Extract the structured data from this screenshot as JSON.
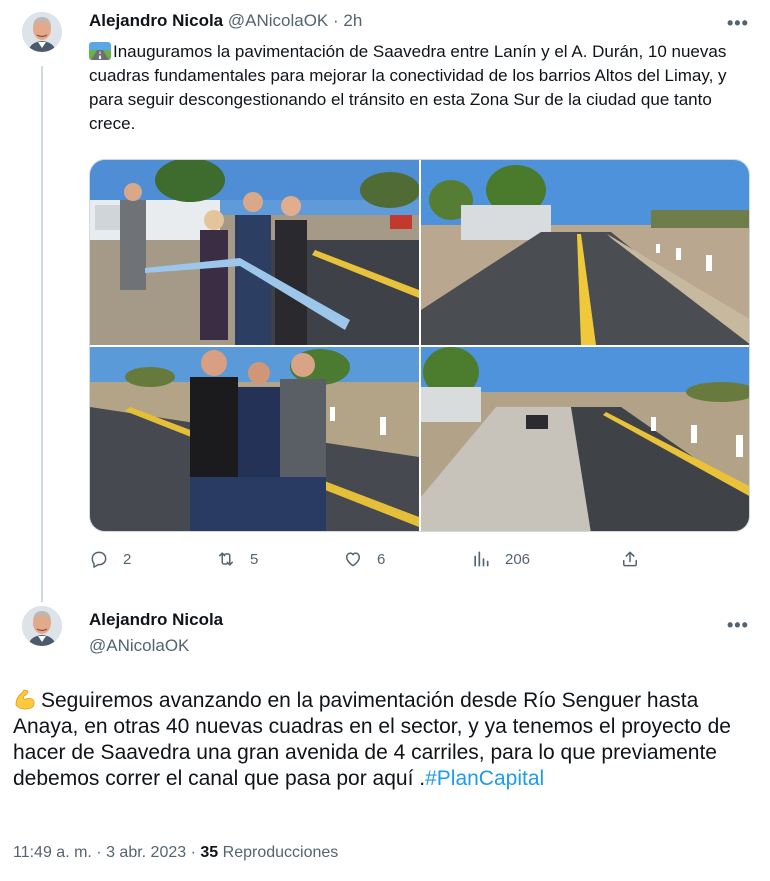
{
  "first_tweet": {
    "author_name": "Alejandro Nicola",
    "author_handle": "@ANicolaOK",
    "separator": "·",
    "time": "2h",
    "more_label": "•••",
    "text": "Inauguramos la pavimentación de Saavedra entre Lanín y el A. Durán, 10 nuevas cuadras fundamentales para mejorar la conectividad de los barrios Altos del Limay, y para seguir descongestionando el tránsito en esta Zona Sur de la ciudad que tanto crece.",
    "emoji": "road-icon",
    "actions": {
      "replies": "2",
      "retweets": "5",
      "likes": "6",
      "views": "206"
    }
  },
  "second_tweet": {
    "author_name": "Alejandro Nicola",
    "author_handle": "@ANicolaOK",
    "more_label": "•••",
    "emoji": "flexed-biceps-icon",
    "text_before_hashtag": "Seguiremos avanzando en la pavimentación desde Río Senguer hasta Anaya, en otras 40 nuevas cuadras en el sector, y ya tenemos el proyecto de hacer de Saavedra una gran avenida de 4 carriles, para lo que previamente debemos correr el canal que pasa por aquí .",
    "hashtag": "#PlanCapital",
    "timestamp": "11:49 a. m. · 3 abr. 2023",
    "separator": "·",
    "views_count": "35",
    "views_label": "Reproducciones"
  },
  "colors": {
    "text_primary": "#0f1419",
    "text_secondary": "#536471",
    "link": "#1d9bf0",
    "border": "#cfd9de"
  }
}
